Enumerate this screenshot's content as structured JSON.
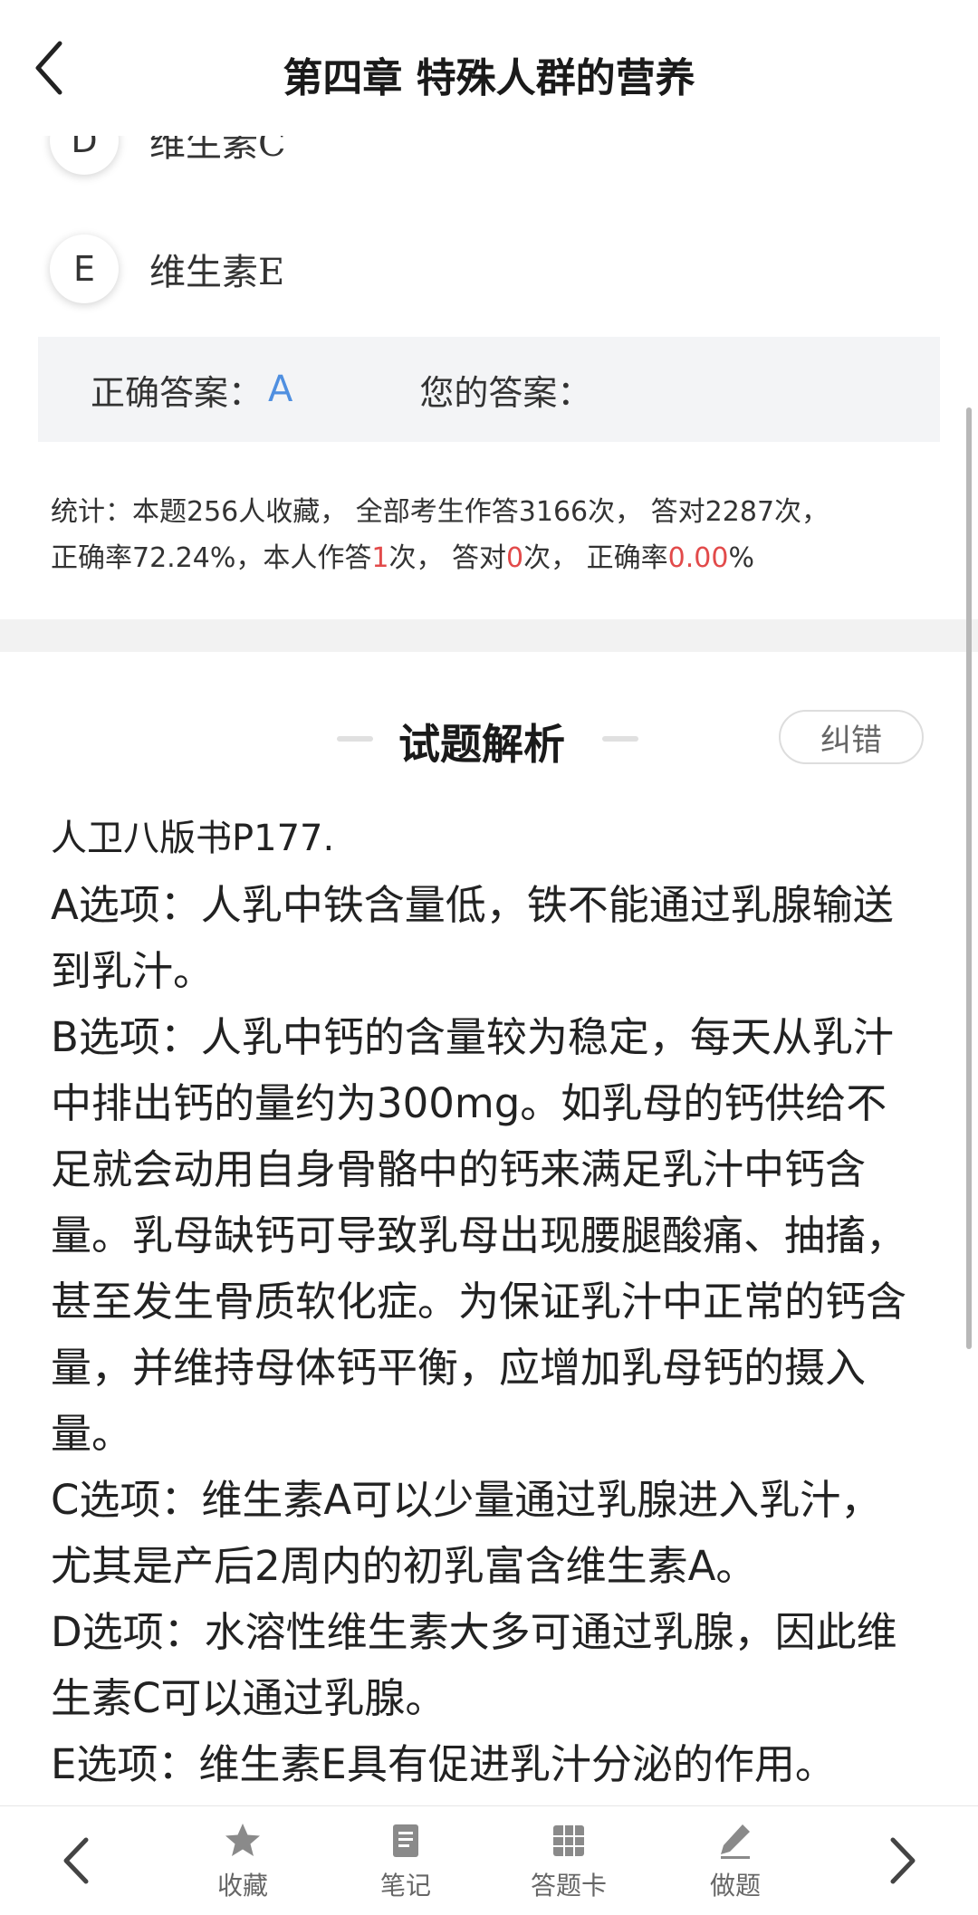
{
  "header": {
    "title": "第四章 特殊人群的营养"
  },
  "options": [
    {
      "letter": "D",
      "text": "维生素C"
    },
    {
      "letter": "E",
      "text": "维生素E"
    }
  ],
  "answer": {
    "correct_label": "正确答案：",
    "correct_value": "A",
    "yours_label": "您的答案："
  },
  "stats": {
    "line1": "统计：本题256人收藏， 全部考生作答3166次， 答对2287次，",
    "line2_a": "正确率72.24%，本人作答",
    "self_count": "1",
    "line2_b": "次， 答对",
    "self_correct": "0",
    "line2_c": "次， 正确率",
    "self_rate": "0.00",
    "line2_d": "%"
  },
  "analysis": {
    "title": "试题解析",
    "report_label": "纠错",
    "paragraphs": [
      "人卫八版书P177.",
      "A选项：人乳中铁含量低，铁不能通过乳腺输送到乳汁。",
      "B选项：人乳中钙的含量较为稳定，每天从乳汁中排出钙的量约为300mg。如乳母的钙供给不足就会动用自身骨骼中的钙来满足乳汁中钙含量。乳母缺钙可导致乳母出现腰腿酸痛、抽搐，甚至发生骨质软化症。为保证乳汁中正常的钙含量，并维持母体钙平衡，应增加乳母钙的摄入量。",
      "C选项：维生素A可以少量通过乳腺进入乳汁，尤其是产后2周内的初乳富含维生素A。",
      "D选项：水溶性维生素大多可通过乳腺，因此维生素C可以通过乳腺。",
      "E选项：维生素E具有促进乳汁分泌的作用。"
    ]
  },
  "bottom_bar": {
    "favorite": "收藏",
    "notes": "笔记",
    "answer_card": "答题卡",
    "do_question": "做题"
  }
}
